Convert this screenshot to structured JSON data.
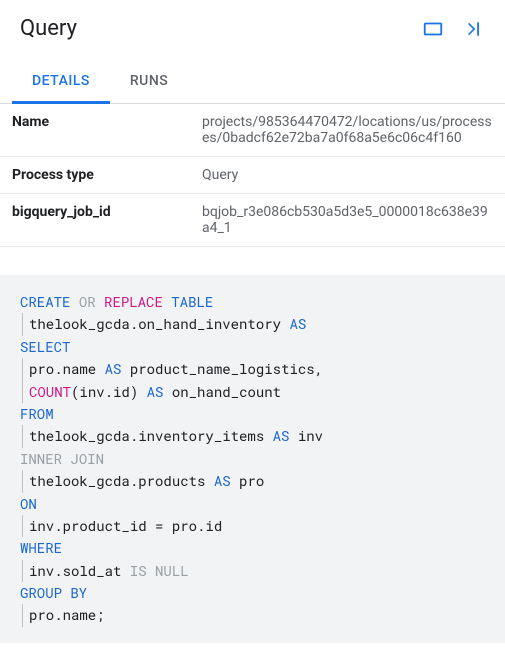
{
  "header": {
    "title": "Query"
  },
  "tabs": {
    "details": "DETAILS",
    "runs": "RUNS"
  },
  "details": {
    "rows": [
      {
        "label": "Name",
        "value": "projects/985364470472/locations/us/processes/0badcf62e72ba7a0f68a5e6c06c4f160"
      },
      {
        "label": "Process type",
        "value": "Query"
      },
      {
        "label": "bigquery_job_id",
        "value": "bqjob_r3e086cb530a5d3e5_0000018c638e39a4_1"
      }
    ]
  },
  "sql": {
    "t1": "CREATE",
    "t2": "OR",
    "t3": "REPLACE",
    "t4": "TABLE",
    "line2a": "thelook_gcda.on_hand_inventory ",
    "line2b": "AS",
    "select": "SELECT",
    "line4a": "pro.name ",
    "line4b": "AS",
    "line4c": " product_name_logistics,",
    "line5a": "COUNT",
    "line5b": "(inv.id) ",
    "line5c": "AS",
    "line5d": " on_hand_count",
    "from": "FROM",
    "line7": "thelook_gcda.inventory_items ",
    "line7b": "AS",
    "line7c": " inv",
    "inner": "INNER",
    "join": "JOIN",
    "line9": "thelook_gcda.products ",
    "line9b": "AS",
    "line9c": " pro",
    "on": "ON",
    "line11": "inv.product_id = pro.id",
    "where": "WHERE",
    "line13a": "inv.sold_at ",
    "line13b": "IS NULL",
    "groupby": "GROUP BY",
    "line15": "pro.name;"
  }
}
